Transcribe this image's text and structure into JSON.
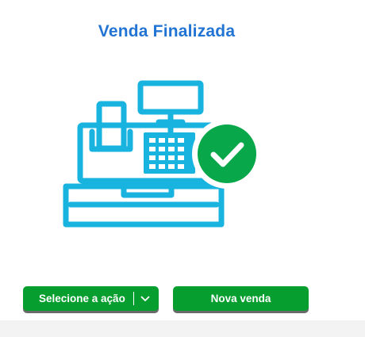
{
  "header": {
    "title": "Venda Finalizada"
  },
  "illustration": {
    "icon": "cash-register-icon",
    "badge_icon": "checkmark-icon",
    "register_color": "#19b3df",
    "badge_color": "#08a84a"
  },
  "actions": {
    "select_action_label": "Selecione a ação",
    "select_action_chevron": "chevron-down-icon",
    "new_sale_label": "Nova venda",
    "button_color": "#069e2e"
  }
}
